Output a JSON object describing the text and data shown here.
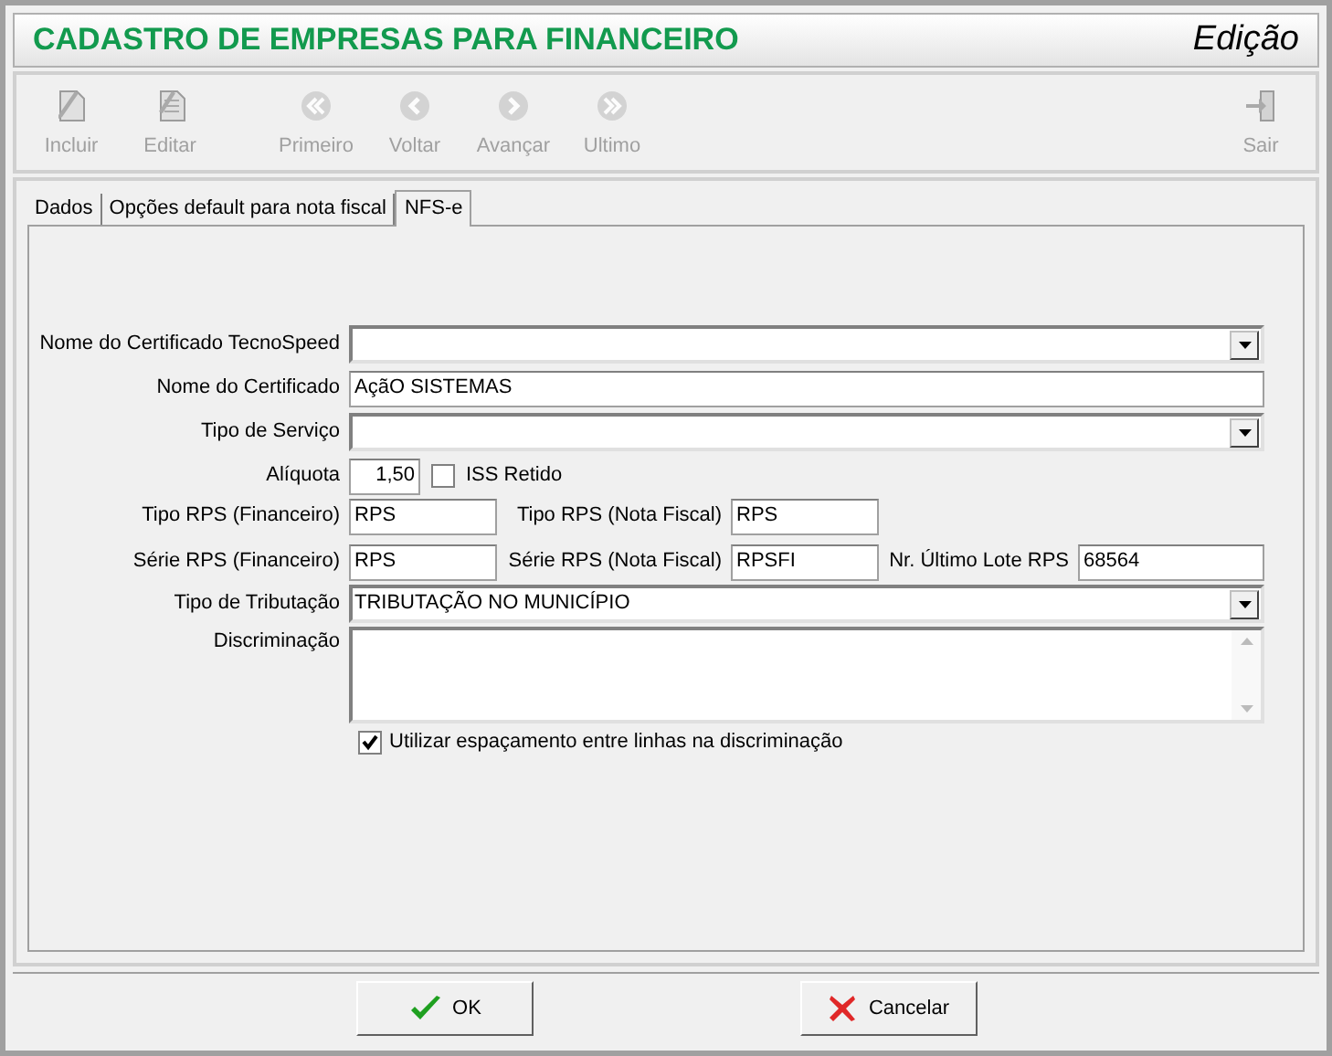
{
  "window": {
    "title": "CADASTRO DE EMPRESAS PARA FINANCEIRO",
    "mode": "Edição"
  },
  "toolbar": [
    {
      "label": "Incluir",
      "kind": "new",
      "disabled": true
    },
    {
      "label": "Editar",
      "kind": "edit",
      "disabled": true
    },
    {
      "label": "Primeiro",
      "kind": "first",
      "disabled": true
    },
    {
      "label": "Voltar",
      "kind": "prev",
      "disabled": true
    },
    {
      "label": "Avançar",
      "kind": "next",
      "disabled": true
    },
    {
      "label": "Ultimo",
      "kind": "last",
      "disabled": true
    },
    {
      "label": "Sair",
      "kind": "exit",
      "disabled": true
    }
  ],
  "tabs": [
    {
      "label": "Dados",
      "selected": false
    },
    {
      "label": "Opções default para nota fiscal",
      "selected": false
    },
    {
      "label": "NFS-e",
      "selected": true
    }
  ],
  "form": {
    "tecnospeed": {
      "label": "Nome do Certificado TecnoSpeed"
    },
    "certificado": {
      "label": "Nome do Certificado",
      "value": "AçãO SISTEMAS"
    },
    "tipo_servico": {
      "label": "Tipo de Serviço"
    },
    "aliquota": {
      "label": "Alíquota",
      "value": "1,50"
    },
    "iss_retido": {
      "label": "ISS Retido",
      "checked": false
    },
    "tipo_rps_fin": {
      "label": "Tipo RPS (Financeiro)",
      "value": "RPS"
    },
    "tipo_rps_nf": {
      "label": "Tipo RPS (Nota Fiscal)",
      "value": "RPS"
    },
    "serie_rps_fin": {
      "label": "Série RPS (Financeiro)",
      "value": "RPS"
    },
    "serie_rps_nf": {
      "label": "Série RPS (Nota Fiscal)",
      "value": "RPSFI"
    },
    "ultimo_lote": {
      "label": "Nr. Último Lote RPS",
      "value": "68564"
    },
    "tributacao": {
      "label": "Tipo de Tributação",
      "value": "TRIBUTAÇÃO NO MUNICÍPIO"
    },
    "discriminacao": {
      "label": "Discriminação"
    },
    "espacamento": {
      "label": "Utilizar espaçamento entre linhas na discriminação",
      "checked": true
    }
  },
  "buttons": [
    {
      "label": "OK",
      "kind": "ok"
    },
    {
      "label": "Cancelar",
      "kind": "cancel"
    }
  ]
}
